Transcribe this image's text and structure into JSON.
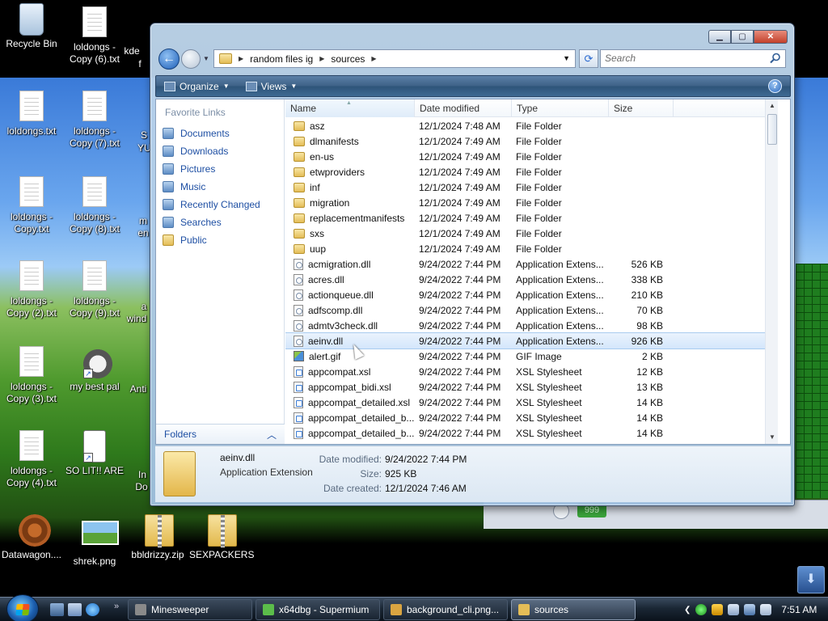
{
  "desktop": {
    "icons": [
      {
        "label": "Recycle Bin"
      },
      {
        "label": "loldongs - Copy (6).txt"
      },
      {
        "label": "loldongs.txt"
      },
      {
        "label": "loldongs - Copy (7).txt"
      },
      {
        "label": "loldongs - Copy.txt"
      },
      {
        "label": "loldongs - Copy (8).txt"
      },
      {
        "label": "loldongs - Copy (2).txt"
      },
      {
        "label": "loldongs - Copy (9).txt"
      },
      {
        "label": "loldongs - Copy (3).txt"
      },
      {
        "label": "my best pal"
      },
      {
        "label": "loldongs - Copy (4).txt"
      },
      {
        "label": "SO LIT!! ARE"
      },
      {
        "label": "Datawagon...."
      },
      {
        "label": "shrek.png"
      },
      {
        "label": "bbldrizzy.zip"
      },
      {
        "label": "SEXPACKERS"
      }
    ],
    "partial_labels": [
      "kde",
      "f",
      "S",
      "YU",
      "m",
      "en",
      "a",
      "wind",
      "Anti",
      "In",
      "Do"
    ],
    "minesweeper_counter": "999"
  },
  "explorer": {
    "breadcrumb": [
      "random files ig",
      "sources"
    ],
    "search_placeholder": "Search",
    "toolbar": {
      "organize": "Organize",
      "views": "Views",
      "help": "?"
    },
    "nav": {
      "title": "Favorite Links",
      "items": [
        "Documents",
        "Downloads",
        "Pictures",
        "Music",
        "Recently Changed",
        "Searches",
        "Public"
      ],
      "folders_label": "Folders"
    },
    "columns": {
      "name": "Name",
      "date": "Date modified",
      "type": "Type",
      "size": "Size"
    },
    "files": [
      {
        "name": "asz",
        "date": "12/1/2024 7:48 AM",
        "type": "File Folder",
        "size": "",
        "icon": "folder"
      },
      {
        "name": "dlmanifests",
        "date": "12/1/2024 7:49 AM",
        "type": "File Folder",
        "size": "",
        "icon": "folder"
      },
      {
        "name": "en-us",
        "date": "12/1/2024 7:49 AM",
        "type": "File Folder",
        "size": "",
        "icon": "folder"
      },
      {
        "name": "etwproviders",
        "date": "12/1/2024 7:49 AM",
        "type": "File Folder",
        "size": "",
        "icon": "folder"
      },
      {
        "name": "inf",
        "date": "12/1/2024 7:49 AM",
        "type": "File Folder",
        "size": "",
        "icon": "folder"
      },
      {
        "name": "migration",
        "date": "12/1/2024 7:49 AM",
        "type": "File Folder",
        "size": "",
        "icon": "folder"
      },
      {
        "name": "replacementmanifests",
        "date": "12/1/2024 7:49 AM",
        "type": "File Folder",
        "size": "",
        "icon": "folder"
      },
      {
        "name": "sxs",
        "date": "12/1/2024 7:49 AM",
        "type": "File Folder",
        "size": "",
        "icon": "folder"
      },
      {
        "name": "uup",
        "date": "12/1/2024 7:49 AM",
        "type": "File Folder",
        "size": "",
        "icon": "folder"
      },
      {
        "name": "acmigration.dll",
        "date": "9/24/2022 7:44 PM",
        "type": "Application Extens...",
        "size": "526 KB",
        "icon": "dll"
      },
      {
        "name": "acres.dll",
        "date": "9/24/2022 7:44 PM",
        "type": "Application Extens...",
        "size": "338 KB",
        "icon": "dll"
      },
      {
        "name": "actionqueue.dll",
        "date": "9/24/2022 7:44 PM",
        "type": "Application Extens...",
        "size": "210 KB",
        "icon": "dll"
      },
      {
        "name": "adfscomp.dll",
        "date": "9/24/2022 7:44 PM",
        "type": "Application Extens...",
        "size": "70 KB",
        "icon": "dll"
      },
      {
        "name": "admtv3check.dll",
        "date": "9/24/2022 7:44 PM",
        "type": "Application Extens...",
        "size": "98 KB",
        "icon": "dll"
      },
      {
        "name": "aeinv.dll",
        "date": "9/24/2022 7:44 PM",
        "type": "Application Extens...",
        "size": "926 KB",
        "icon": "dll",
        "selected": true
      },
      {
        "name": "alert.gif",
        "date": "9/24/2022 7:44 PM",
        "type": "GIF Image",
        "size": "2 KB",
        "icon": "gif"
      },
      {
        "name": "appcompat.xsl",
        "date": "9/24/2022 7:44 PM",
        "type": "XSL Stylesheet",
        "size": "12 KB",
        "icon": "xsl"
      },
      {
        "name": "appcompat_bidi.xsl",
        "date": "9/24/2022 7:44 PM",
        "type": "XSL Stylesheet",
        "size": "13 KB",
        "icon": "xsl"
      },
      {
        "name": "appcompat_detailed.xsl",
        "date": "9/24/2022 7:44 PM",
        "type": "XSL Stylesheet",
        "size": "14 KB",
        "icon": "xsl"
      },
      {
        "name": "appcompat_detailed_b...",
        "date": "9/24/2022 7:44 PM",
        "type": "XSL Stylesheet",
        "size": "14 KB",
        "icon": "xsl"
      },
      {
        "name": "appcompat_detailed_b...",
        "date": "9/24/2022 7:44 PM",
        "type": "XSL Stylesheet",
        "size": "14 KB",
        "icon": "xsl"
      }
    ],
    "details": {
      "name": "aeinv.dll",
      "type": "Application Extension",
      "date_modified_label": "Date modified:",
      "date_modified": "9/24/2022 7:44 PM",
      "size_label": "Size:",
      "size": "925 KB",
      "date_created_label": "Date created:",
      "date_created": "12/1/2024 7:46 AM"
    }
  },
  "taskbar": {
    "quicklaunch_more": "»",
    "tasks": [
      {
        "label": "Minesweeper",
        "color": "#8a8a8a"
      },
      {
        "label": "x64dbg - Supermium",
        "color": "#5bbd4a"
      },
      {
        "label": "background_cli.png...",
        "color": "#d9a441"
      },
      {
        "label": "sources",
        "color": "#e4bd57",
        "active": true
      }
    ],
    "clock": "7:51 AM"
  }
}
